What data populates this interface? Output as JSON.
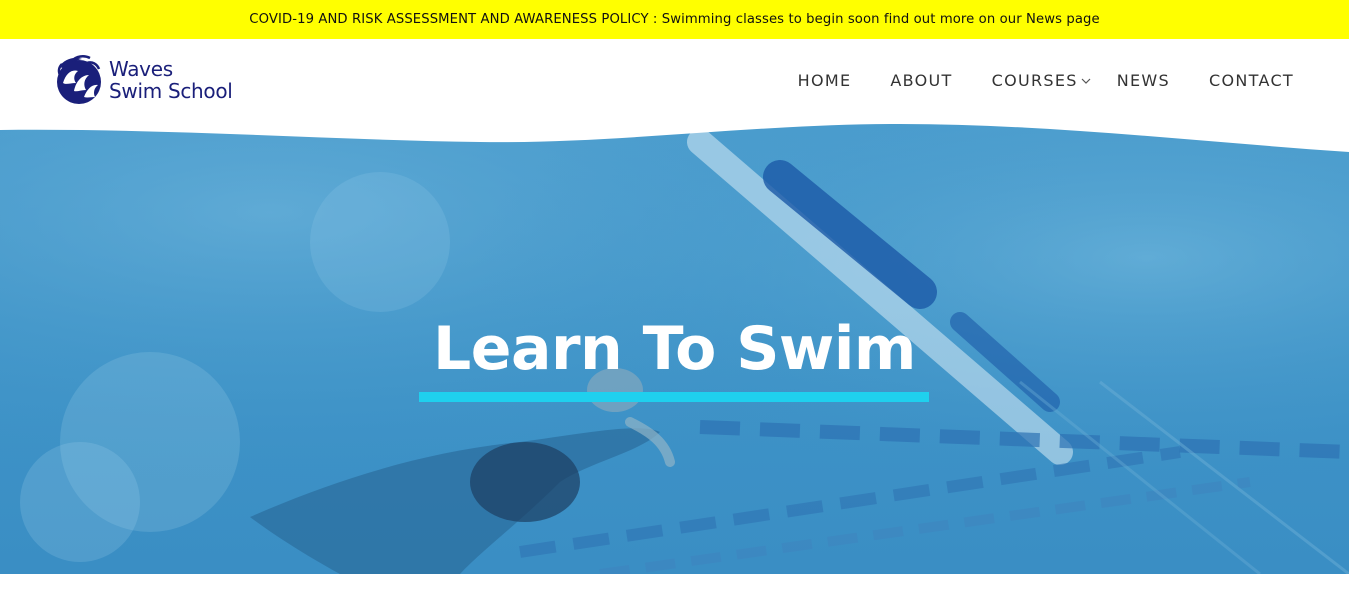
{
  "announcement": {
    "text": "COVID-19 AND RISK ASSESSMENT AND AWARENESS POLICY : Swimming classes to begin soon find out more on our News page"
  },
  "logo": {
    "line1": "Waves",
    "line2": "Swim School",
    "icon": "wave-emblem-icon"
  },
  "nav": {
    "items": [
      {
        "label": "HOME"
      },
      {
        "label": "ABOUT"
      },
      {
        "label": "COURSES",
        "icon": "chevron-down-icon"
      },
      {
        "label": "NEWS"
      },
      {
        "label": "CONTACT"
      }
    ]
  },
  "hero": {
    "title": "Learn To Swim"
  },
  "colors": {
    "announcement_bg": "#ffff00",
    "brand_navy": "#1a1f7a",
    "hero_overlay": "#3f94c8",
    "accent_underline": "#1fd0ee"
  }
}
